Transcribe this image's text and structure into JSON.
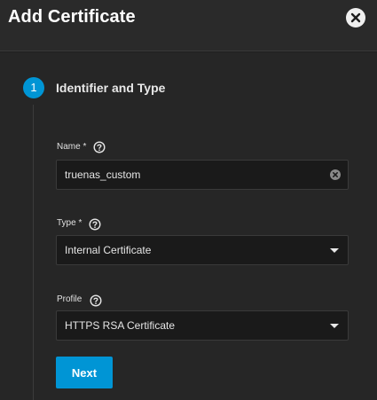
{
  "dialog": {
    "title": "Add Certificate",
    "close_icon": "close-circle-icon"
  },
  "stepper": {
    "step_number": "1",
    "step_title": "Identifier and Type",
    "accent_color": "#0095d5"
  },
  "form": {
    "name": {
      "label": "Name *",
      "value": "truenas_custom",
      "help_icon": "help-circle-icon",
      "clear_icon": "clear-circle-icon"
    },
    "type": {
      "label": "Type *",
      "selected": "Internal Certificate",
      "help_icon": "help-circle-icon"
    },
    "profile": {
      "label": "Profile",
      "selected": "HTTPS RSA Certificate",
      "help_icon": "help-circle-icon"
    }
  },
  "actions": {
    "next_label": "Next"
  }
}
